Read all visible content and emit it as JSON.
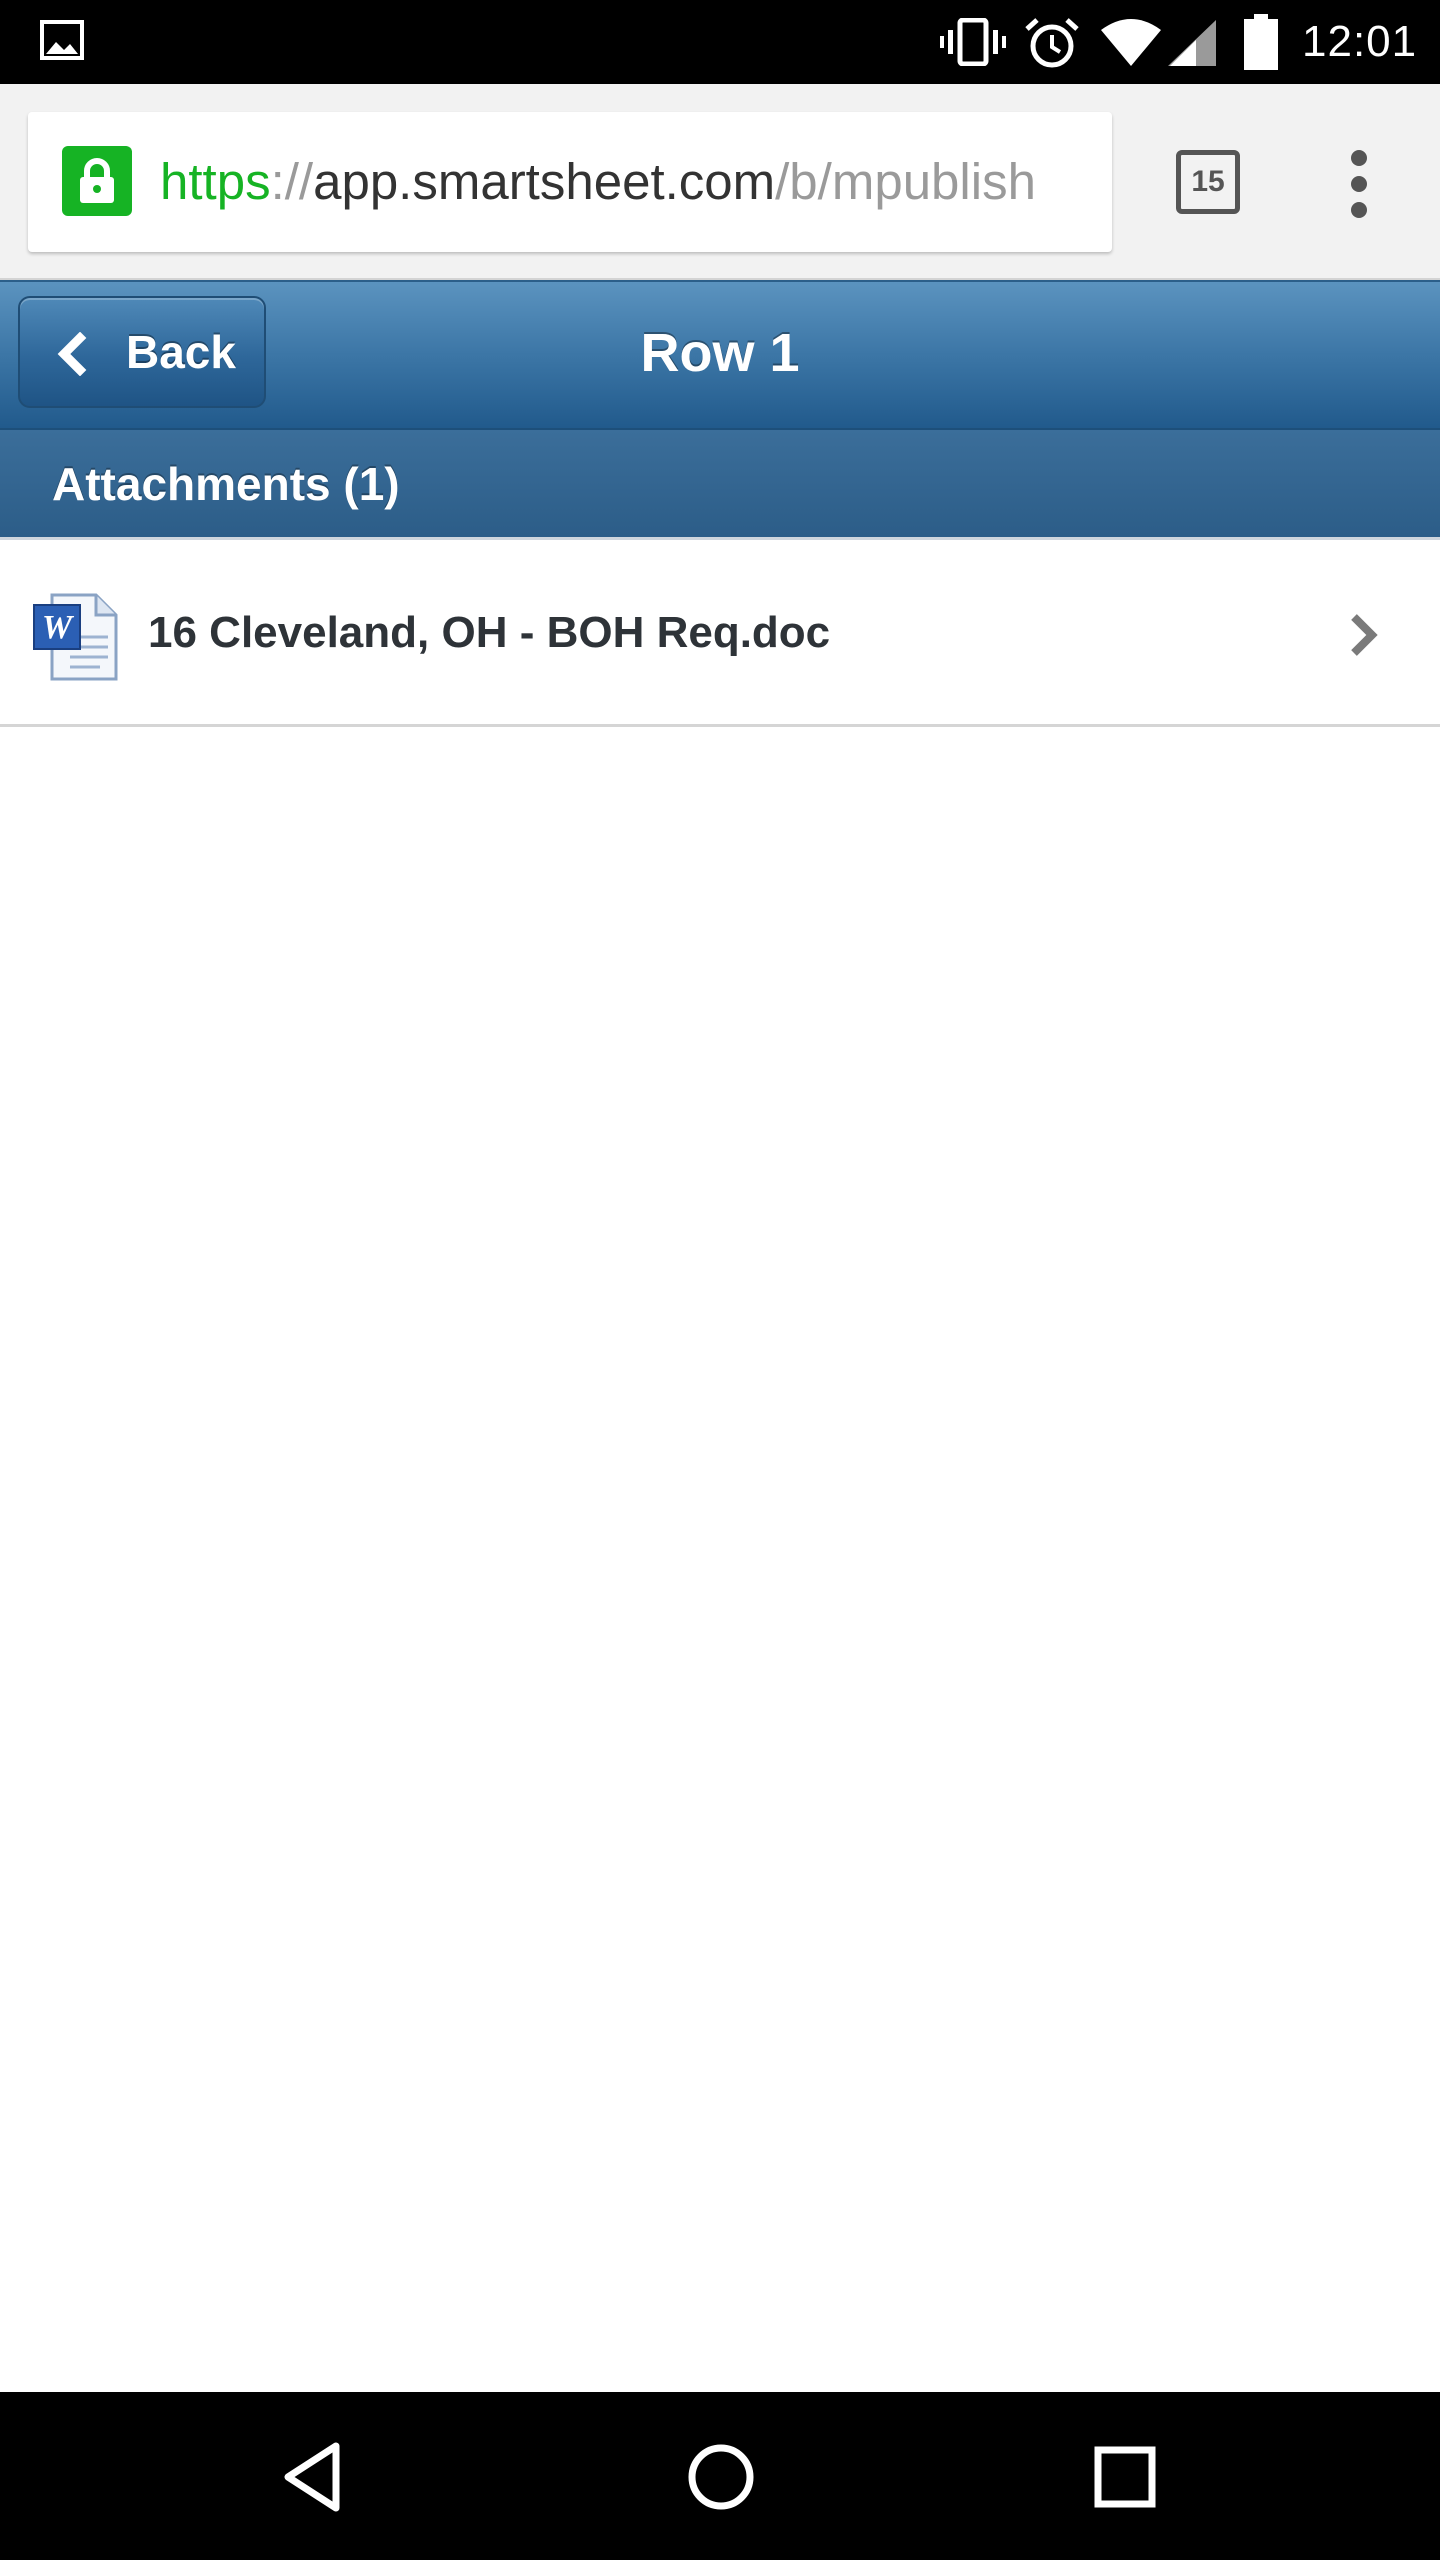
{
  "status_bar": {
    "time": "12:01",
    "icons": [
      "gallery-icon",
      "vibrate-icon",
      "alarm-icon",
      "wifi-icon",
      "signal-icon",
      "battery-icon"
    ]
  },
  "browser": {
    "url_scheme": "https",
    "url_separator": "://",
    "url_host": "app.smartsheet.com",
    "url_path": "/b/mpublish",
    "tab_count": "15",
    "colors": {
      "secure": "#16b324"
    }
  },
  "header": {
    "back_label": "Back",
    "title": "Row 1"
  },
  "attachments": {
    "section_title": "Attachments (1)",
    "items": [
      {
        "name": "16 Cleveland, OH - BOH Req.doc",
        "icon": "word-doc-icon"
      }
    ]
  },
  "nav_bar": {
    "buttons": [
      "back-triangle-icon",
      "home-circle-icon",
      "recents-square-icon"
    ]
  },
  "theme": {
    "header_blue": "#3c76a6",
    "section_blue": "#2c5d88"
  }
}
